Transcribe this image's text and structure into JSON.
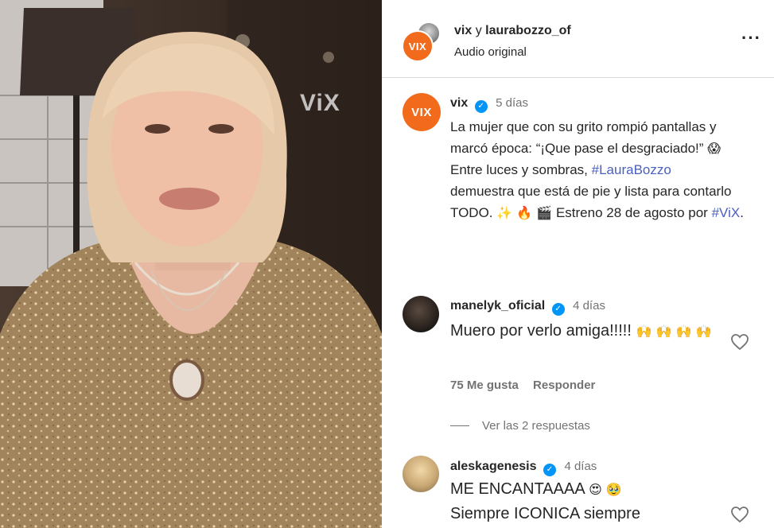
{
  "media": {
    "watermark": "ViX"
  },
  "header": {
    "account_1": "vix",
    "joiner": "y",
    "account_2": "laurabozzo_of",
    "audio": "Audio original",
    "avatar_label": "VIX",
    "more": "···"
  },
  "caption": {
    "avatar_label": "VIX",
    "username": "vix",
    "time": "5 días",
    "line1": "La mujer que con su grito rompió pantallas y marcó época: “¡Que pase el desgraciado!”",
    "emoji1": "😱",
    "line2_pre": "Entre luces y sombras,",
    "hashtag1": "#LauraBozzo",
    "line2_post": "demuestra que está de pie y lista para contarlo TODO.",
    "emoji2": "✨ 🔥 🎬",
    "line3": "Estreno 28 de agosto por",
    "hashtag2": "#ViX",
    "line3_end": "."
  },
  "comments": [
    {
      "username": "manelyk_oficial",
      "time": "4 días",
      "text": "Muero por verlo amiga!!!!!",
      "emoji": "🙌 🙌 🙌 🙌",
      "likes": "75 Me gusta",
      "reply": "Responder",
      "view_replies": "Ver las 2 respuestas"
    },
    {
      "username": "aleskagenesis",
      "time": "4 días",
      "text": "ME ENCANTAAAA",
      "emoji": "😍 🥹",
      "text2": "Siempre ICONICA siempre"
    }
  ],
  "colors": {
    "brand": "#f26b1d",
    "verified": "#0095f6",
    "hashtag": "#4a5fc1",
    "muted": "#737373"
  },
  "icons": [
    "verified-badge-icon",
    "heart-icon",
    "more-options-icon"
  ]
}
